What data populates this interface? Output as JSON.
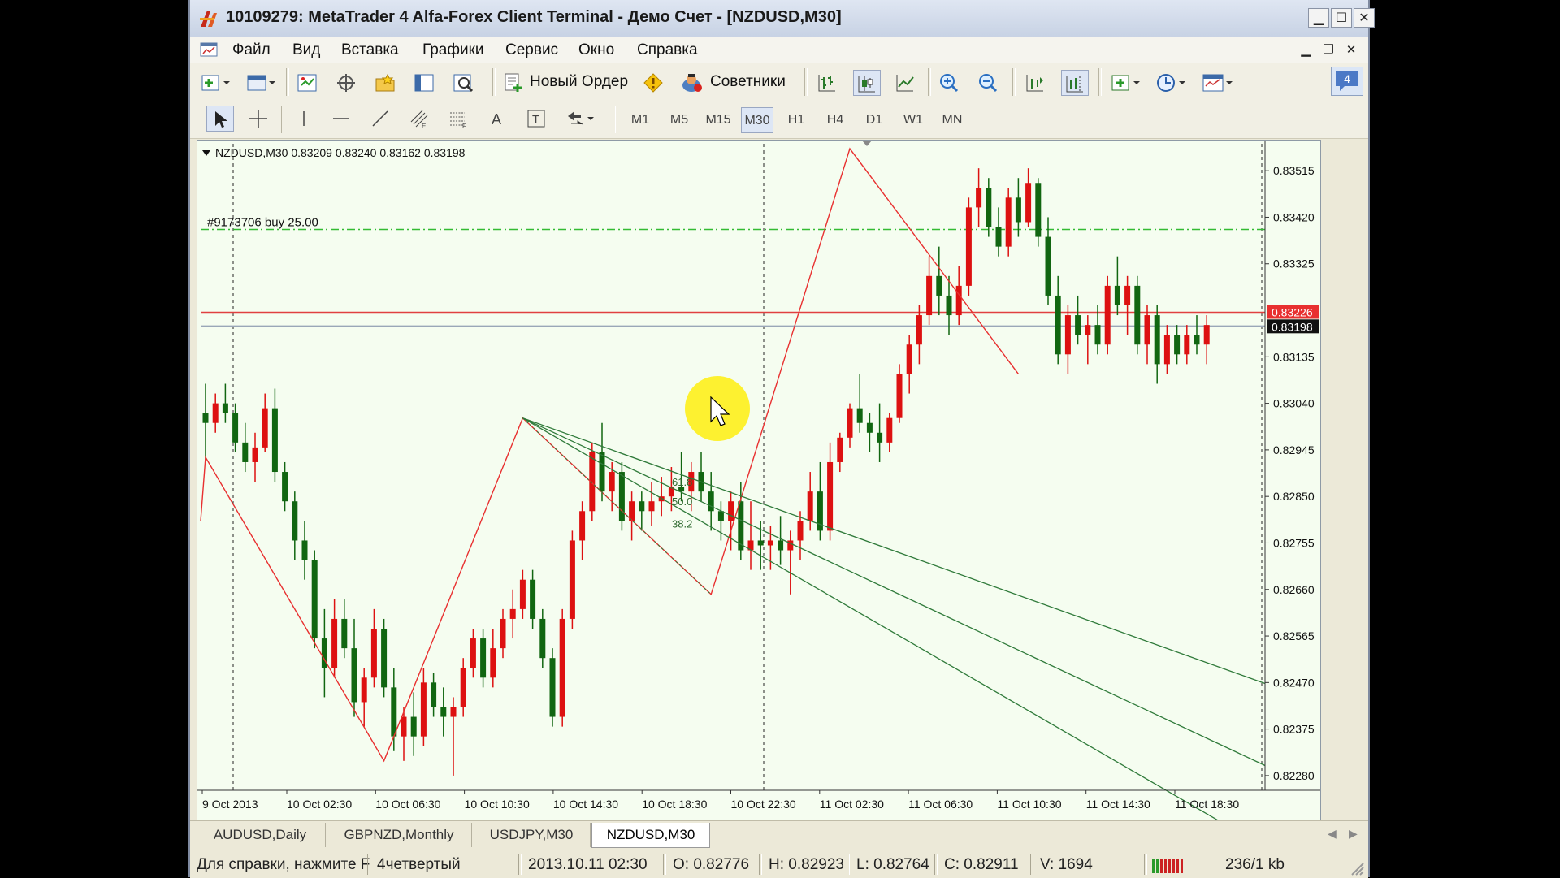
{
  "window": {
    "title": "10109279: MetaTrader 4 Alfa-Forex Client Terminal - Демо Счет - [NZDUSD,M30]",
    "minimize_icon": "minimize-icon",
    "maximize_icon": "maximize-icon",
    "close_icon": "close-icon"
  },
  "menu": {
    "items": [
      "Файл",
      "Вид",
      "Вставка",
      "Графики",
      "Сервис",
      "Окно",
      "Справка"
    ]
  },
  "toolbar": {
    "new_order_label": "Новый Ордер",
    "experts_label": "Советники",
    "badge_count": "4",
    "timeframes": [
      "M1",
      "M5",
      "M15",
      "M30",
      "H1",
      "H4",
      "D1",
      "W1",
      "MN"
    ],
    "selected_timeframe": "M30"
  },
  "chart": {
    "header": "NZDUSD,M30  0.83209 0.83240 0.83162 0.83198",
    "order_label": "#9173706 buy 25.00",
    "fib_labels": [
      "61.8",
      "50.0",
      "38.2"
    ],
    "bid_price": "0.83226",
    "last_price": "0.83198",
    "colors": {
      "background": "#f5fdf0",
      "bull": "#dd1111",
      "bear": "#116611",
      "zigzag": "#e83030",
      "fan": "#2f7a3a",
      "order_line": "#33bb33",
      "bid_line": "#e04040",
      "ask_line": "#9aa7b8",
      "highlight": "#ffee00"
    }
  },
  "chart_data": {
    "type": "candlestick",
    "symbol": "NZDUSD",
    "timeframe": "M30",
    "y_ticks": [
      "0.83515",
      "0.83420",
      "0.83325",
      "0.83135",
      "0.83040",
      "0.82945",
      "0.82850",
      "0.82755",
      "0.82660",
      "0.82565",
      "0.82470",
      "0.82375",
      "0.82280"
    ],
    "x_ticks": [
      "9 Oct 2013",
      "10 Oct 02:30",
      "10 Oct 06:30",
      "10 Oct 10:30",
      "10 Oct 14:30",
      "10 Oct 18:30",
      "10 Oct 22:30",
      "11 Oct 02:30",
      "11 Oct 06:30",
      "11 Oct 10:30",
      "11 Oct 14:30",
      "11 Oct 18:30"
    ],
    "ylim": [
      0.8225,
      0.8357
    ],
    "order_price": 0.83395,
    "bid_price": 0.83226,
    "ask_price": 0.83198,
    "candles": [
      [
        0.8302,
        0.8308,
        0.8292,
        0.83
      ],
      [
        0.83,
        0.8306,
        0.8298,
        0.8304
      ],
      [
        0.8304,
        0.8308,
        0.83,
        0.8302
      ],
      [
        0.8302,
        0.8304,
        0.8294,
        0.8296
      ],
      [
        0.8296,
        0.83,
        0.829,
        0.8292
      ],
      [
        0.8292,
        0.8298,
        0.8288,
        0.8295
      ],
      [
        0.8295,
        0.8306,
        0.8294,
        0.8303
      ],
      [
        0.8303,
        0.8307,
        0.8288,
        0.829
      ],
      [
        0.829,
        0.8292,
        0.8282,
        0.8284
      ],
      [
        0.8284,
        0.8286,
        0.8272,
        0.8276
      ],
      [
        0.8276,
        0.828,
        0.8268,
        0.8272
      ],
      [
        0.8272,
        0.8274,
        0.8254,
        0.8256
      ],
      [
        0.8256,
        0.8262,
        0.8244,
        0.825
      ],
      [
        0.825,
        0.8264,
        0.8248,
        0.826
      ],
      [
        0.826,
        0.8264,
        0.8252,
        0.8254
      ],
      [
        0.8254,
        0.826,
        0.824,
        0.8243
      ],
      [
        0.8243,
        0.825,
        0.8238,
        0.8248
      ],
      [
        0.8248,
        0.8262,
        0.8246,
        0.8258
      ],
      [
        0.8258,
        0.826,
        0.8244,
        0.8246
      ],
      [
        0.8246,
        0.825,
        0.8233,
        0.8236
      ],
      [
        0.8236,
        0.8242,
        0.8231,
        0.824
      ],
      [
        0.824,
        0.8245,
        0.8232,
        0.8236
      ],
      [
        0.8236,
        0.825,
        0.8234,
        0.8247
      ],
      [
        0.8247,
        0.8249,
        0.824,
        0.8242
      ],
      [
        0.8242,
        0.8246,
        0.8236,
        0.824
      ],
      [
        0.824,
        0.8244,
        0.8228,
        0.8242
      ],
      [
        0.8242,
        0.8252,
        0.824,
        0.825
      ],
      [
        0.825,
        0.8258,
        0.8248,
        0.8256
      ],
      [
        0.8256,
        0.8258,
        0.8246,
        0.8248
      ],
      [
        0.8248,
        0.8258,
        0.8246,
        0.8254
      ],
      [
        0.8254,
        0.8262,
        0.8252,
        0.826
      ],
      [
        0.826,
        0.8266,
        0.8256,
        0.8262
      ],
      [
        0.8262,
        0.827,
        0.826,
        0.8268
      ],
      [
        0.8268,
        0.827,
        0.8258,
        0.826
      ],
      [
        0.826,
        0.8262,
        0.825,
        0.8252
      ],
      [
        0.8252,
        0.8254,
        0.8238,
        0.824
      ],
      [
        0.824,
        0.8262,
        0.8238,
        0.826
      ],
      [
        0.826,
        0.8278,
        0.8258,
        0.8276
      ],
      [
        0.8276,
        0.8284,
        0.8272,
        0.8282
      ],
      [
        0.8282,
        0.8296,
        0.828,
        0.8294
      ],
      [
        0.8294,
        0.83,
        0.8284,
        0.8286
      ],
      [
        0.8286,
        0.8292,
        0.8282,
        0.829
      ],
      [
        0.829,
        0.8292,
        0.8278,
        0.828
      ],
      [
        0.828,
        0.8286,
        0.8276,
        0.8284
      ],
      [
        0.8284,
        0.8286,
        0.8278,
        0.8282
      ],
      [
        0.8282,
        0.8288,
        0.8279,
        0.8284
      ],
      [
        0.8284,
        0.8289,
        0.8281,
        0.8285
      ],
      [
        0.8285,
        0.8291,
        0.8282,
        0.8287
      ],
      [
        0.8287,
        0.8294,
        0.8284,
        0.8286
      ],
      [
        0.8286,
        0.8292,
        0.8282,
        0.829
      ],
      [
        0.829,
        0.8294,
        0.8284,
        0.8286
      ],
      [
        0.8286,
        0.829,
        0.8278,
        0.8282
      ],
      [
        0.8282,
        0.8284,
        0.8276,
        0.828
      ],
      [
        0.828,
        0.8286,
        0.8274,
        0.8284
      ],
      [
        0.8284,
        0.8288,
        0.8272,
        0.8274
      ],
      [
        0.8274,
        0.8284,
        0.827,
        0.8276
      ],
      [
        0.8276,
        0.828,
        0.827,
        0.8275
      ],
      [
        0.8275,
        0.8279,
        0.827,
        0.8276
      ],
      [
        0.8276,
        0.8281,
        0.8271,
        0.8274
      ],
      [
        0.8274,
        0.8278,
        0.8265,
        0.8276
      ],
      [
        0.8276,
        0.8282,
        0.8272,
        0.828
      ],
      [
        0.828,
        0.829,
        0.8278,
        0.8286
      ],
      [
        0.8286,
        0.8292,
        0.8276,
        0.8278
      ],
      [
        0.8278,
        0.8296,
        0.8276,
        0.8292
      ],
      [
        0.8292,
        0.8298,
        0.829,
        0.8297
      ],
      [
        0.8297,
        0.8304,
        0.8295,
        0.8303
      ],
      [
        0.8303,
        0.831,
        0.8298,
        0.83
      ],
      [
        0.83,
        0.8302,
        0.8294,
        0.8298
      ],
      [
        0.8298,
        0.8304,
        0.8292,
        0.8296
      ],
      [
        0.8296,
        0.8302,
        0.8294,
        0.8301
      ],
      [
        0.8301,
        0.8312,
        0.83,
        0.831
      ],
      [
        0.831,
        0.8318,
        0.8306,
        0.8316
      ],
      [
        0.8316,
        0.8324,
        0.8312,
        0.8322
      ],
      [
        0.8322,
        0.8334,
        0.832,
        0.833
      ],
      [
        0.833,
        0.8336,
        0.8322,
        0.8326
      ],
      [
        0.8326,
        0.833,
        0.8318,
        0.8322
      ],
      [
        0.8322,
        0.8332,
        0.832,
        0.8328
      ],
      [
        0.8328,
        0.8346,
        0.8326,
        0.8344
      ],
      [
        0.8344,
        0.8352,
        0.834,
        0.8348
      ],
      [
        0.8348,
        0.835,
        0.8338,
        0.834
      ],
      [
        0.834,
        0.8344,
        0.8334,
        0.8336
      ],
      [
        0.8336,
        0.8348,
        0.8334,
        0.8346
      ],
      [
        0.8346,
        0.835,
        0.8338,
        0.8341
      ],
      [
        0.8341,
        0.8352,
        0.834,
        0.8349
      ],
      [
        0.8349,
        0.835,
        0.8336,
        0.8338
      ],
      [
        0.8338,
        0.8342,
        0.8324,
        0.8326
      ],
      [
        0.8326,
        0.833,
        0.8312,
        0.8314
      ],
      [
        0.8314,
        0.8324,
        0.831,
        0.8322
      ],
      [
        0.8322,
        0.8326,
        0.8316,
        0.8318
      ],
      [
        0.8318,
        0.8322,
        0.8312,
        0.832
      ],
      [
        0.832,
        0.8324,
        0.8314,
        0.8316
      ],
      [
        0.8316,
        0.833,
        0.8314,
        0.8328
      ],
      [
        0.8328,
        0.8334,
        0.8322,
        0.8324
      ],
      [
        0.8324,
        0.833,
        0.8318,
        0.8328
      ],
      [
        0.8328,
        0.833,
        0.8314,
        0.8316
      ],
      [
        0.8316,
        0.8324,
        0.8312,
        0.8322
      ],
      [
        0.8322,
        0.8324,
        0.8308,
        0.8312
      ],
      [
        0.8312,
        0.832,
        0.831,
        0.8318
      ],
      [
        0.8318,
        0.832,
        0.8312,
        0.8314
      ],
      [
        0.8314,
        0.832,
        0.8312,
        0.8318
      ],
      [
        0.8318,
        0.8322,
        0.8314,
        0.8316
      ],
      [
        0.8316,
        0.8322,
        0.8312,
        0.832
      ]
    ]
  },
  "tabs": [
    "AUDUSD,Daily",
    "GBPNZD,Monthly",
    "USDJPY,M30",
    "NZDUSD,M30"
  ],
  "active_tab": "NZDUSD,M30",
  "status": {
    "help": "Для справки, нажмите F",
    "profile": "4четвертый",
    "datetime": "2013.10.11 02:30",
    "open": "O: 0.82776",
    "high": "H: 0.82923",
    "low": "L: 0.82764",
    "close": "C: 0.82911",
    "volume": "V: 1694",
    "traffic": "236/1 kb"
  }
}
